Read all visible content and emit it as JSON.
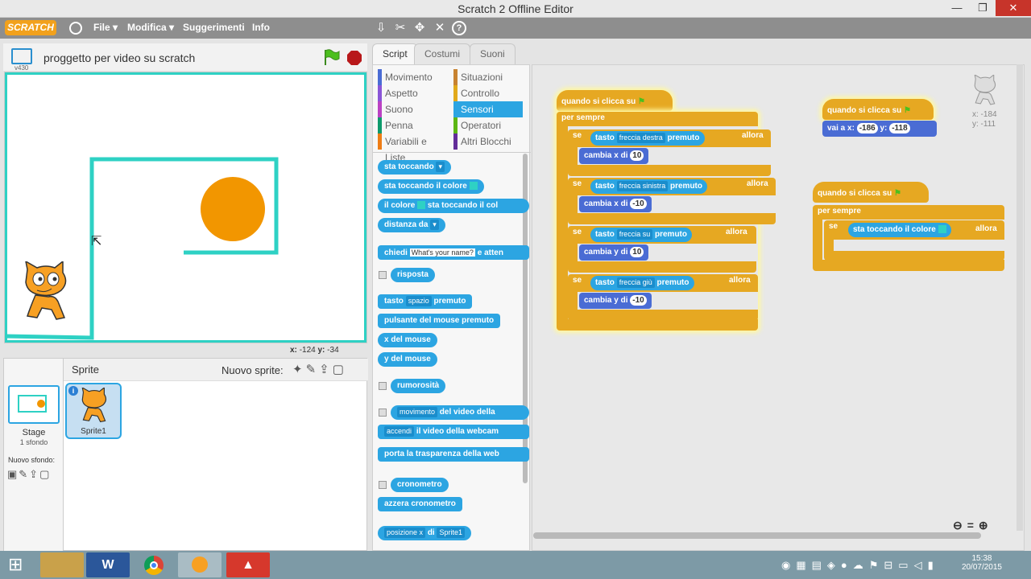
{
  "window": {
    "title": "Scratch 2 Offline Editor",
    "minimize": "—",
    "maximize": "❐",
    "close": "✕"
  },
  "menubar": {
    "logo": "SCRATCH",
    "items": [
      "File ▾",
      "Modifica ▾",
      "Suggerimenti",
      "Info"
    ]
  },
  "stage": {
    "project_name": "proggetto per video su scratch",
    "version": "v430",
    "mouse_x_label": "x:",
    "mouse_x": "-124",
    "mouse_y_label": "y:",
    "mouse_y": "-34"
  },
  "sprites": {
    "header": "Sprite",
    "new_sprite_label": "Nuovo sprite:",
    "stage_label": "Stage",
    "stage_backdrops": "1 sfondo",
    "new_backdrop_label": "Nuovo sfondo:",
    "sprite_name": "Sprite1"
  },
  "tabs": [
    "Script",
    "Costumi",
    "Suoni"
  ],
  "categories": [
    {
      "label": "Movimento",
      "color": "#4a6cd4"
    },
    {
      "label": "Situazioni",
      "color": "#c88330"
    },
    {
      "label": "Aspetto",
      "color": "#8a55d7"
    },
    {
      "label": "Controllo",
      "color": "#e1a91a"
    },
    {
      "label": "Suono",
      "color": "#bb42c3"
    },
    {
      "label": "Sensori",
      "color": "#2ca5e2"
    },
    {
      "label": "Penna",
      "color": "#0e9a6c"
    },
    {
      "label": "Operatori",
      "color": "#5cb712"
    },
    {
      "label": "Variabili e Liste",
      "color": "#ee7d16"
    },
    {
      "label": "Altri Blocchi",
      "color": "#632d99"
    }
  ],
  "palette_blocks": {
    "touching": "sta toccando",
    "touching_color": "sta toccando il colore",
    "color_touching_a": "il colore",
    "color_touching_b": "sta toccando il col",
    "distance": "distanza da",
    "ask_a": "chiedi",
    "ask_default": "What's your name?",
    "ask_b": "e atten",
    "answer": "risposta",
    "key_a": "tasto",
    "key_value": "spazio",
    "key_b": "premuto",
    "mouse_down": "pulsante del mouse premuto",
    "mouse_x": "x del mouse",
    "mouse_y": "y del mouse",
    "loudness": "rumorosità",
    "video_motion_dd": "movimento",
    "video_motion": "del video della",
    "video_on_dd": "accendi",
    "video_on": "il video della webcam",
    "video_transparency": "porta la trasparenza della web",
    "timer": "cronometro",
    "reset_timer": "azzera cronometro",
    "of_dd": "posizione x",
    "of_mid": "di",
    "of_sprite": "Sprite1"
  },
  "script1": {
    "hat": "quando si clicca su",
    "forever": "per sempre",
    "if": "se",
    "then": "allora",
    "key": "tasto",
    "pressed": "premuto",
    "keys": [
      "freccia destra",
      "freccia sinistra",
      "freccia su",
      "freccia giù"
    ],
    "moves": [
      {
        "label_a": "cambia",
        "axis": "x",
        "label_b": "di",
        "value": "10"
      },
      {
        "label_a": "cambia",
        "axis": "x",
        "label_b": "di",
        "value": "-10"
      },
      {
        "label_a": "cambia",
        "axis": "y",
        "label_b": "di",
        "value": "10"
      },
      {
        "label_a": "cambia",
        "axis": "y",
        "label_b": "di",
        "value": "-10"
      }
    ]
  },
  "script2": {
    "hat": "quando si clicca su",
    "goto_a": "vai a x:",
    "x": "-186",
    "goto_b": "y:",
    "y": "-118"
  },
  "script3": {
    "hat": "quando si clicca su",
    "forever": "per sempre",
    "if": "se",
    "touching_color": "sta toccando il colore",
    "then": "allora"
  },
  "sprite_info": {
    "x": "x: -184",
    "y": "y: -111"
  },
  "taskbar": {
    "time": "15:38",
    "date": "20/07/2015"
  }
}
